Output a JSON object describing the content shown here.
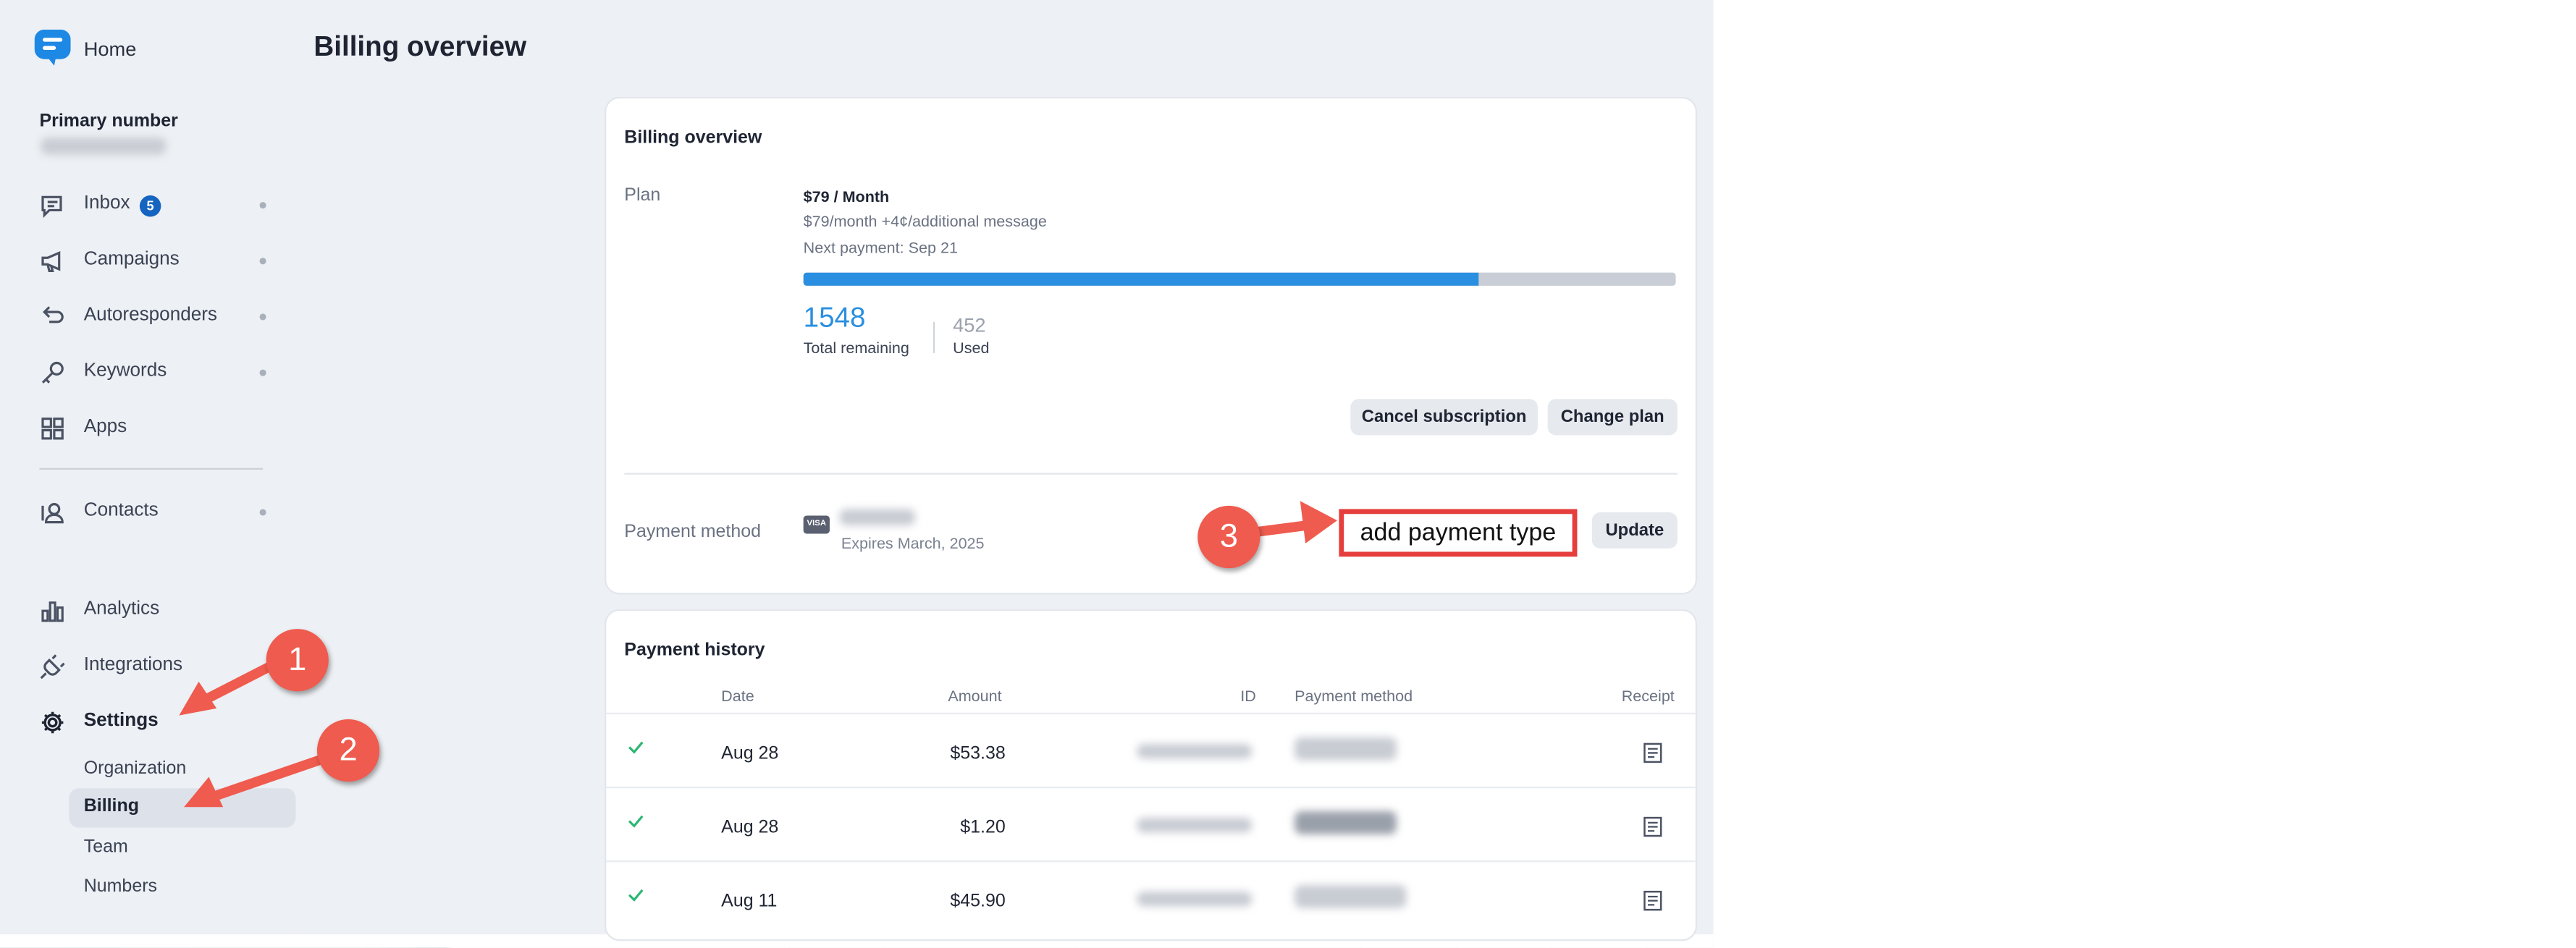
{
  "sidebar": {
    "home_label": "Home",
    "primary_number_label": "Primary number",
    "nav_items": [
      {
        "label": "Inbox",
        "badge": "5"
      },
      {
        "label": "Campaigns"
      },
      {
        "label": "Autoresponders"
      },
      {
        "label": "Keywords"
      },
      {
        "label": "Apps"
      },
      {
        "label": "Contacts"
      },
      {
        "label": "Analytics"
      },
      {
        "label": "Integrations"
      },
      {
        "label": "Settings"
      }
    ],
    "settings_subitems": [
      "Organization",
      "Billing",
      "Team",
      "Numbers"
    ],
    "active_subitem": "Billing"
  },
  "page": {
    "title": "Billing overview"
  },
  "billing_card": {
    "title": "Billing overview",
    "plan_label": "Plan",
    "plan_name": "$79 / Month",
    "plan_detail": "$79/month +4¢/additional message",
    "next_payment": "Next payment: Sep 21",
    "usage_fraction": 0.774,
    "remaining_value": "1548",
    "remaining_label": "Total remaining",
    "used_value": "452",
    "used_label": "Used",
    "cancel_button": "Cancel subscription",
    "change_button": "Change plan",
    "payment_method_label": "Payment method",
    "card_brand": "VISA",
    "card_expiry": "Expires March, 2025",
    "update_button": "Update"
  },
  "annotations": {
    "step1": "1",
    "step2": "2",
    "step3": "3",
    "callout_text": "add payment type",
    "color": "#e63d3d"
  },
  "history": {
    "title": "Payment history",
    "columns": {
      "date": "Date",
      "amount": "Amount",
      "id": "ID",
      "method": "Payment method",
      "receipt": "Receipt"
    },
    "rows": [
      {
        "date": "Aug 28",
        "amount": "$53.38"
      },
      {
        "date": "Aug 28",
        "amount": "$1.20"
      },
      {
        "date": "Aug 11",
        "amount": "$45.90"
      }
    ]
  },
  "background": {
    "row_number": "32"
  },
  "colors": {
    "accent": "#2a8fe0",
    "success": "#2bb673",
    "badge": "#1565c0",
    "annotation": "#ef5b4e"
  }
}
